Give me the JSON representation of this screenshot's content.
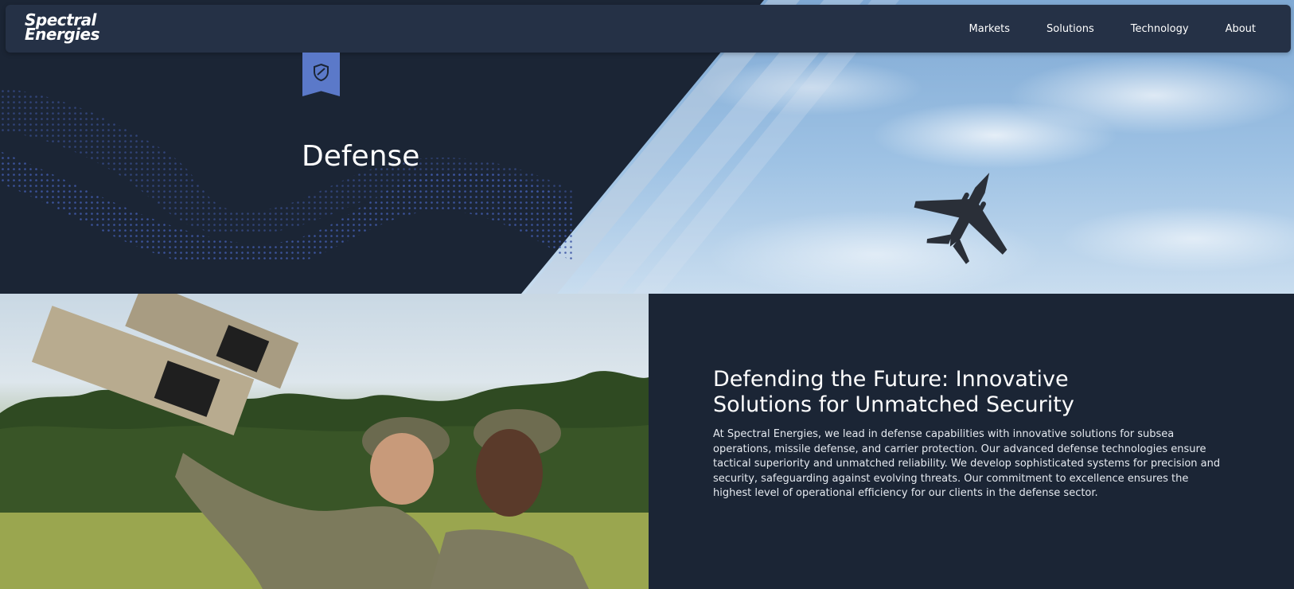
{
  "brand": {
    "line1": "Spectral",
    "line2": "Energies"
  },
  "nav": {
    "items": [
      {
        "label": "Markets"
      },
      {
        "label": "Solutions"
      },
      {
        "label": "Technology"
      },
      {
        "label": "About"
      }
    ]
  },
  "hero": {
    "badge_icon": "shield-icon",
    "title": "Defense",
    "image": "fighter-jet-in-sky"
  },
  "section": {
    "image": "soldiers-with-counter-drone-devices",
    "heading": "Defending the Future: Innovative Solutions for Unmatched Security",
    "body": "At Spectral Energies, we lead in defense capabilities with innovative solutions for subsea operations, missile defense, and carrier protection. Our advanced defense technologies ensure tactical superiority and unmatched reliability. We develop sophisticated systems for precision and security, safeguarding against evolving threats. Our commitment to excellence ensures the highest level of operational efficiency for our clients in the defense sector."
  },
  "colors": {
    "navy": "#1b2535",
    "nav_bar": "#253146",
    "accent": "#5b79c9"
  }
}
